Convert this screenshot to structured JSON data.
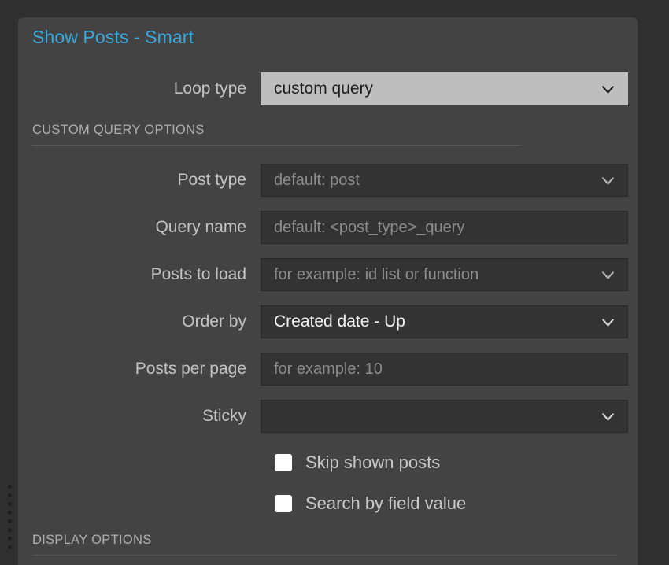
{
  "panel": {
    "title": "Show Posts - Smart",
    "accent_color": "#36a9dd",
    "background_color": "#434343"
  },
  "loop_type": {
    "label": "Loop type",
    "value": "custom query",
    "chevron_icon": "chevron-down-icon"
  },
  "sections": {
    "custom_query": {
      "label": "CUSTOM QUERY OPTIONS"
    },
    "display": {
      "label": "DISPLAY OPTIONS"
    }
  },
  "fields": {
    "post_type": {
      "label": "Post type",
      "value": "",
      "placeholder": "default: post",
      "chevron_icon": "chevron-down-icon"
    },
    "query_name": {
      "label": "Query name",
      "value": "",
      "placeholder": "default: <post_type>_query"
    },
    "posts_to_load": {
      "label": "Posts to load",
      "value": "",
      "placeholder": "for example: id list or function",
      "chevron_icon": "chevron-down-icon"
    },
    "order_by": {
      "label": "Order by",
      "value": "Created date - Up",
      "chevron_icon": "chevron-down-icon"
    },
    "posts_per_page": {
      "label": "Posts per page",
      "value": "",
      "placeholder": "for example: 10"
    },
    "sticky": {
      "label": "Sticky",
      "value": "",
      "placeholder": "",
      "chevron_icon": "chevron-down-icon"
    }
  },
  "checkboxes": {
    "skip_shown_posts": {
      "label": "Skip shown posts",
      "checked": false
    },
    "search_by_field_value": {
      "label": "Search by field value",
      "checked": false
    }
  },
  "drag_handle": {
    "name": "drag-handle-dots",
    "dot_count": 8
  }
}
